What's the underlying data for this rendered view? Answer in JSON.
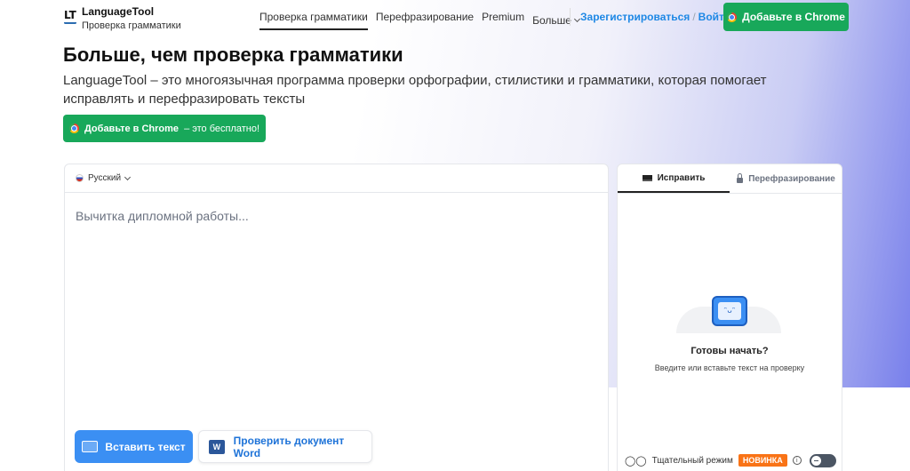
{
  "header": {
    "brand": "LanguageTool",
    "brand_sub": "Проверка грамматики",
    "logo_mark": "LT",
    "nav": [
      {
        "label": "Проверка грамматики",
        "active": true
      },
      {
        "label": "Перефразирование",
        "active": false
      },
      {
        "label": "Premium",
        "active": false
      },
      {
        "label": "Больше",
        "active": false
      }
    ],
    "register_label": "Зарегистрироваться",
    "auth_separator": "/",
    "login_label": "Войти",
    "chrome_button_label": "Добавьте в Chrome"
  },
  "hero": {
    "title": "Больше, чем проверка грамматики",
    "description": "LanguageTool – это многоязычная программа проверки орфографии, стилистики и грамматики, которая помогает исправлять и перефразировать тексты",
    "chrome_button_bold": "Добавьте в Chrome",
    "chrome_button_rest": "– это бесплатно!"
  },
  "editor": {
    "language": "Русский",
    "placeholder": "Вычитка дипломной работы...",
    "paste_button": "Вставить текст",
    "word_button": "Проверить документ Word",
    "word_icon_letter": "W"
  },
  "panel": {
    "tab_fix": "Исправить",
    "tab_paraphrase": "Перефразирование",
    "ready_title": "Готовы начать?",
    "ready_subtitle": "Введите или вставьте текст на проверку",
    "thorough_mode": "Тщательный режим",
    "new_badge": "НОВИНКА",
    "robot_face": "ᵔᴗᵔ",
    "toggle_on": false
  },
  "colors": {
    "brand_green": "#18a85a",
    "link_blue": "#1e88e5",
    "primary_blue": "#3b8ff3",
    "badge_orange": "#f97316"
  }
}
